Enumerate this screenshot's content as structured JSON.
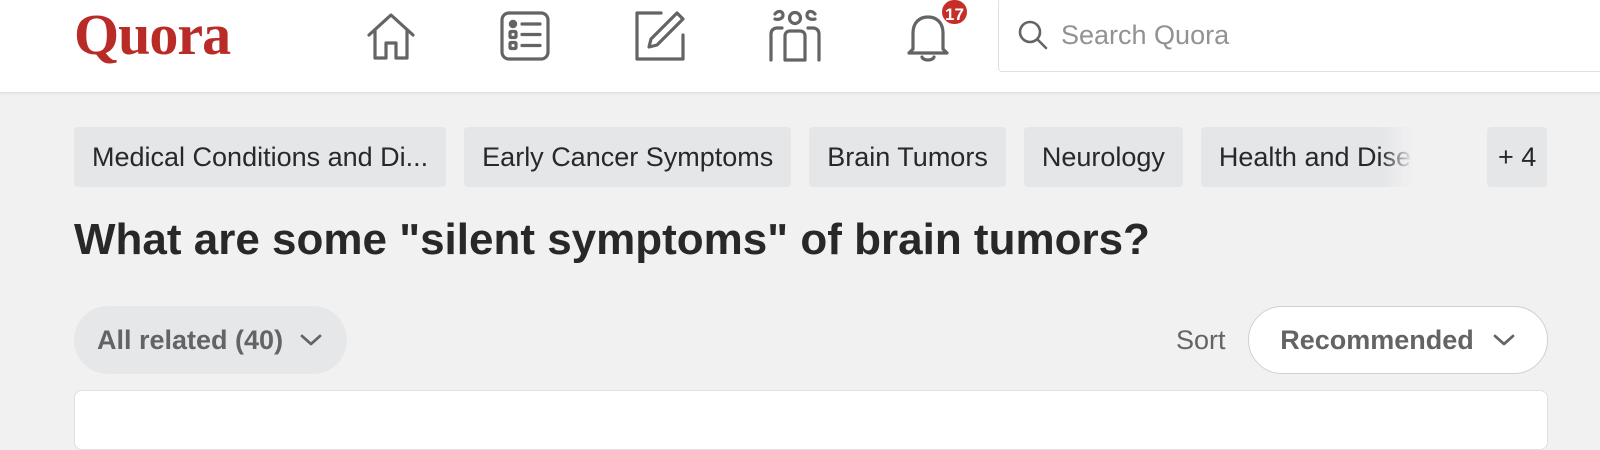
{
  "header": {
    "logo_text": "Quora",
    "brand_color": "#b92b27",
    "nav": [
      {
        "name": "home",
        "icon": "home-icon"
      },
      {
        "name": "following",
        "icon": "following-list-icon"
      },
      {
        "name": "answer",
        "icon": "pencil-square-icon"
      },
      {
        "name": "spaces",
        "icon": "people-group-icon"
      },
      {
        "name": "notifications",
        "icon": "bell-icon",
        "badge": "17",
        "badge_color": "#c62f28"
      }
    ],
    "search": {
      "placeholder": "Search Quora",
      "value": ""
    }
  },
  "topics": {
    "items": [
      {
        "label": "Medical Conditions and Di..."
      },
      {
        "label": "Early Cancer Symptoms"
      },
      {
        "label": "Brain Tumors"
      },
      {
        "label": "Neurology"
      },
      {
        "label": "Health and Diseases"
      }
    ],
    "more_label": "+ 4"
  },
  "question": {
    "title": "What are some \"silent symptoms\" of brain tumors?"
  },
  "filters": {
    "related_label": "All related (40)",
    "sort_label": "Sort",
    "sort_value": "Recommended"
  }
}
